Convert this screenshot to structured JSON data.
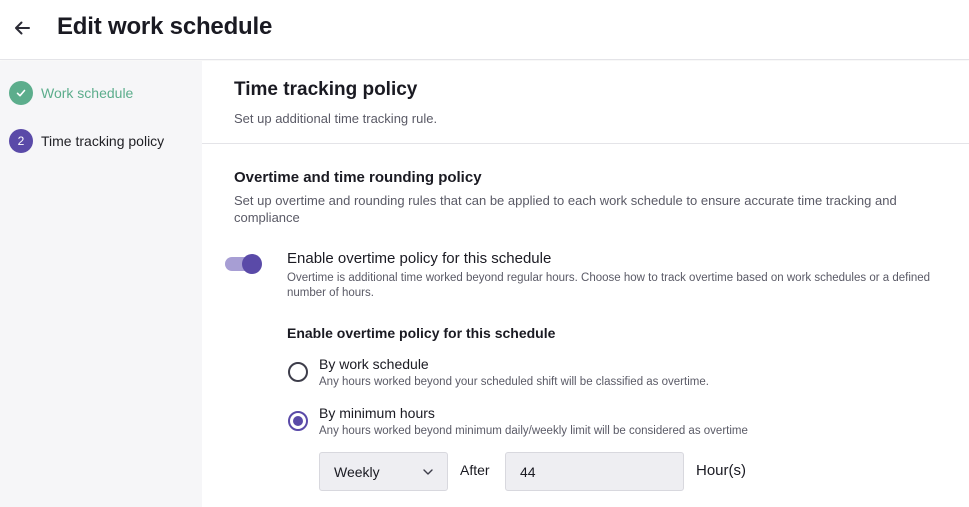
{
  "header": {
    "title": "Edit work schedule",
    "back_icon": "arrow-left-icon"
  },
  "sidebar": {
    "steps": [
      {
        "number": "",
        "label": "Work schedule",
        "status": "completed",
        "icon": "check-icon"
      },
      {
        "number": "2",
        "label": "Time tracking policy",
        "status": "current"
      }
    ]
  },
  "section": {
    "title": "Time tracking policy",
    "subtitle": "Set up additional time tracking rule."
  },
  "overtime": {
    "title": "Overtime and time rounding policy",
    "description": "Set up overtime and rounding rules that can be applied to each work schedule to ensure accurate time tracking and compliance",
    "toggle": {
      "enabled": true,
      "label": "Enable overtime policy for this schedule",
      "description": "Overtime is additional time worked beyond regular hours. Choose how to track overtime based on work schedules or a defined number of hours."
    },
    "policy_heading": "Enable overtime policy for this schedule",
    "options": [
      {
        "label": "By work schedule",
        "description": "Any hours worked beyond your scheduled shift will be classified as overtime.",
        "selected": false
      },
      {
        "label": "By minimum hours",
        "description": "Any hours worked beyond minimum daily/weekly limit will be considered as overtime",
        "selected": true
      }
    ],
    "period": {
      "selected": "Weekly"
    },
    "after_label": "After",
    "hours": {
      "value": "44"
    },
    "hours_unit": "Hour(s)"
  },
  "colors": {
    "accent": "#5a4aa8",
    "accent_light": "#a79ed4",
    "success": "#5cad8c"
  }
}
